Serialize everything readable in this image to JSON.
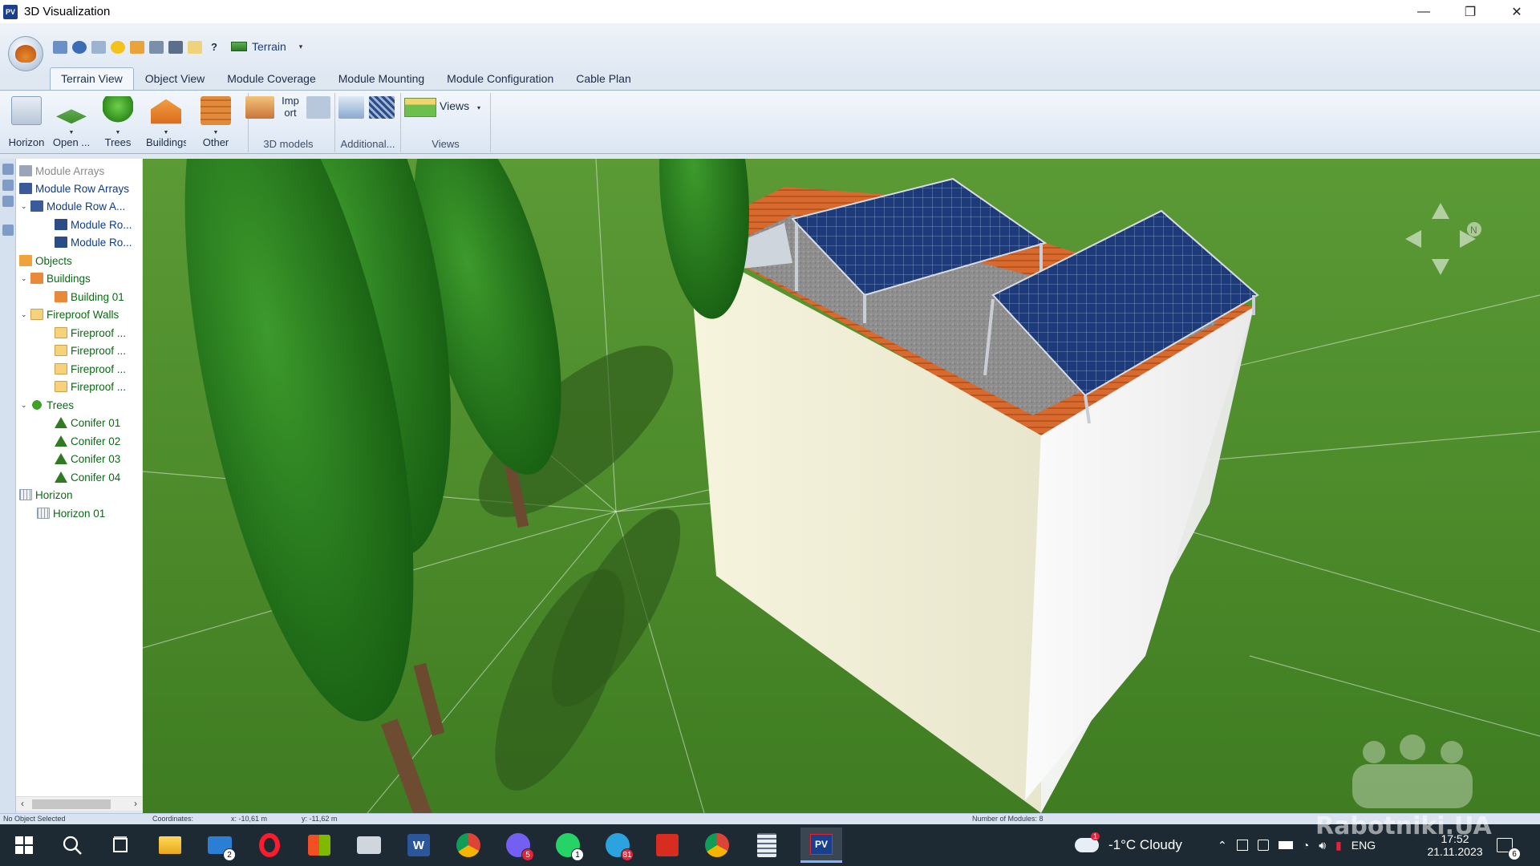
{
  "window": {
    "title": "3D Visualization",
    "minimize": "—",
    "restore": "❐",
    "close": "✕"
  },
  "quickbar": {
    "terrain_label": "Terrain",
    "caret": "▾"
  },
  "tabs": [
    {
      "label": "Terrain View"
    },
    {
      "label": "Object View"
    },
    {
      "label": "Module Coverage"
    },
    {
      "label": "Module Mounting"
    },
    {
      "label": "Module Configuration"
    },
    {
      "label": "Cable Plan"
    }
  ],
  "ribbon": {
    "buttons": {
      "horizon": "Horizon",
      "open": "Open ...",
      "trees": "Trees",
      "buildings": "Buildings",
      "other": "Other",
      "import": "Imp ort",
      "views": "Views"
    },
    "groups": {
      "models": "3D models",
      "additional": "Additional...",
      "views": "Views"
    }
  },
  "tree": {
    "module_arrays": "Module Arrays",
    "module_row_arrays": "Module Row Arrays",
    "module_row_a": "Module Row A...",
    "module_ro_1": "Module Ro...",
    "module_ro_2": "Module Ro...",
    "objects": "Objects",
    "buildings": "Buildings",
    "building_01": "Building 01",
    "fireproof_walls": "Fireproof Walls",
    "fireproof_1": "Fireproof ...",
    "fireproof_2": "Fireproof ...",
    "fireproof_3": "Fireproof ...",
    "fireproof_4": "Fireproof ...",
    "trees": "Trees",
    "conifer_01": "Conifer 01",
    "conifer_02": "Conifer 02",
    "conifer_03": "Conifer 03",
    "conifer_04": "Conifer 04",
    "horizon": "Horizon",
    "horizon_01": "Horizon 01"
  },
  "viewport": {
    "north_label": "N"
  },
  "statusbar": {
    "selection": "No Object Selected",
    "coords_label": "Coordinates:",
    "x": "x: -10,61 m",
    "y": "y: -11,62 m",
    "modules": "Number of Modules: 8"
  },
  "taskbar": {
    "badges": {
      "mail": "2",
      "viber": "5",
      "whatsapp": "1",
      "telegram": "81"
    },
    "weather": "-1°C  Cloudy",
    "weather_alert": "1",
    "lang": "ENG",
    "time": "17:52",
    "date": "21.11.2023",
    "notif_count": "6"
  },
  "watermark": "Rabotniki.UA",
  "colors": {
    "accent": "#1a3f8c",
    "ribbon": "#dbe6f3",
    "grass": "#4a8a28",
    "taskbar": "#1e2a33"
  }
}
